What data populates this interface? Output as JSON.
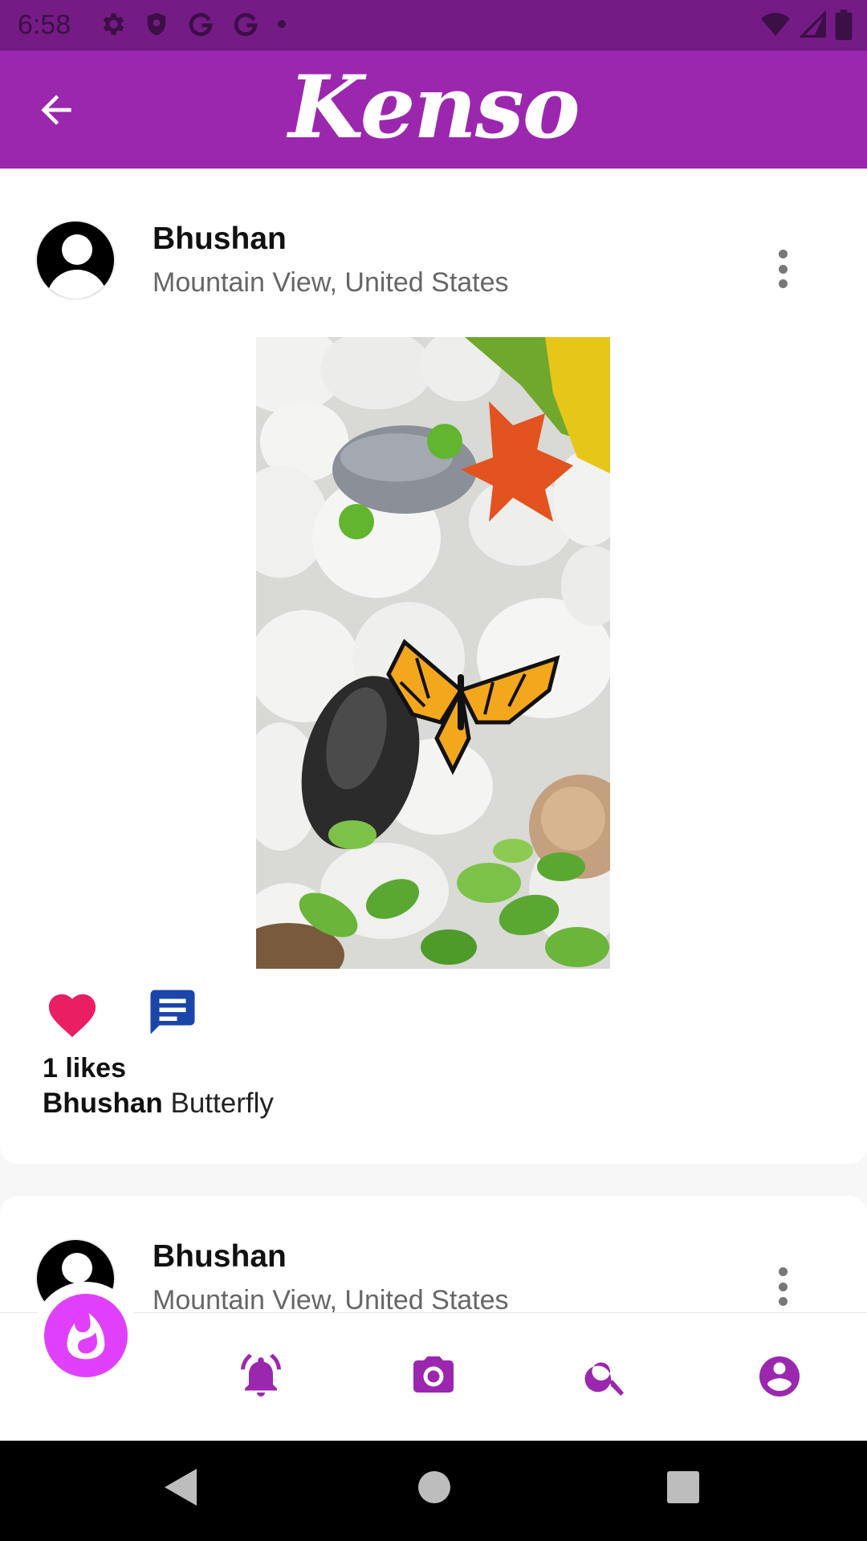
{
  "status_bar": {
    "time": "6:58",
    "icons": [
      "settings-icon",
      "shield-icon",
      "google-icon",
      "google-icon",
      "notification-dot-icon",
      "wifi-icon",
      "signal-icon",
      "battery-icon"
    ]
  },
  "app_bar": {
    "title": "Kenso",
    "back_icon": "arrow-back-icon"
  },
  "posts": [
    {
      "user": "Bhushan",
      "location": "Mountain View, United States",
      "image_alt": "Butterfly on white pebbles with leaves",
      "likes_text": "1 likes",
      "caption_user": "Bhushan",
      "caption_text": "Butterfly",
      "liked": true
    },
    {
      "user": "Bhushan",
      "location": "Mountain View, United States"
    }
  ],
  "bottom_nav": {
    "items": [
      "fire-icon",
      "notifications-icon",
      "camera-icon",
      "search-icon",
      "account-icon"
    ]
  },
  "colors": {
    "status_bar": "#751b86",
    "app_bar": "#9b27af",
    "accent": "#9b27af",
    "fab": "#e040fb",
    "like": "#ea1e63",
    "comment": "#1946a8"
  }
}
